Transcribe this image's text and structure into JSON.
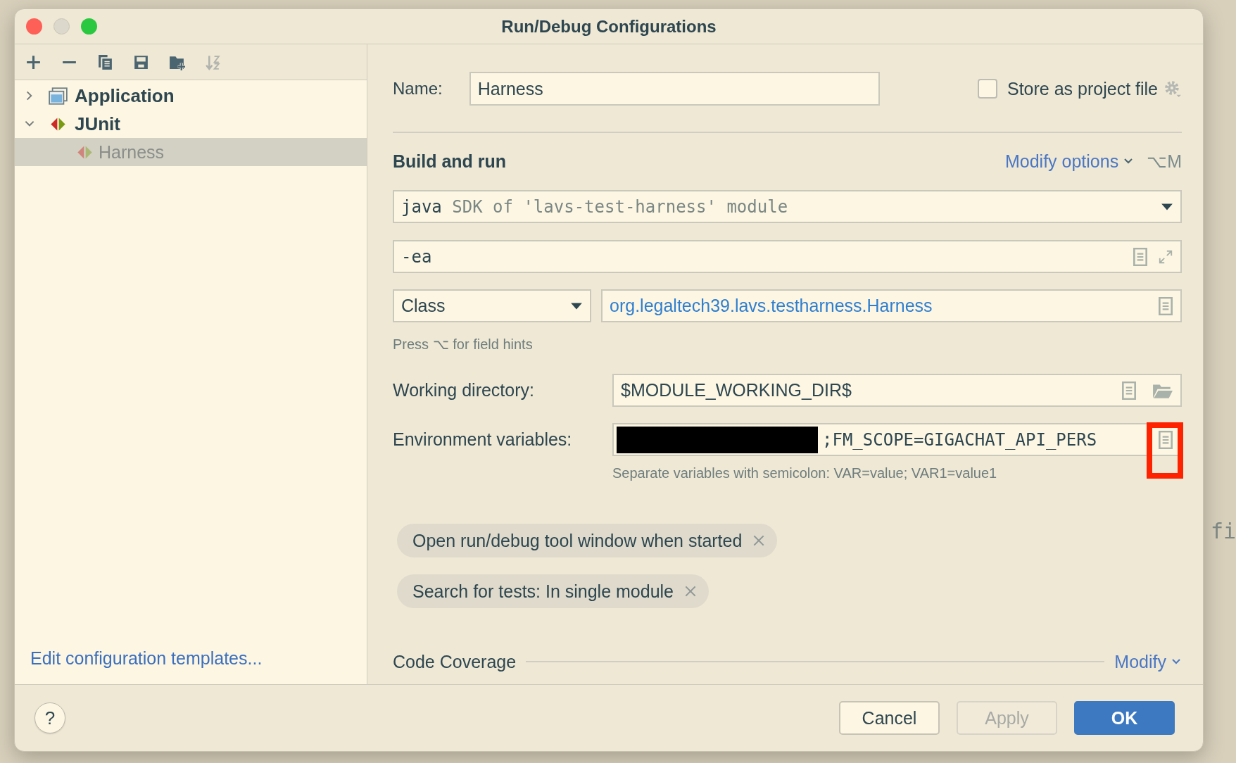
{
  "window": {
    "title": "Run/Debug Configurations"
  },
  "tree": [
    {
      "label": "Application",
      "kind": "application",
      "expanded": false,
      "selected": false
    },
    {
      "label": "JUnit",
      "kind": "junit",
      "expanded": true,
      "selected": false,
      "children": [
        {
          "label": "Harness",
          "selected": true,
          "dimmed": true
        }
      ]
    }
  ],
  "templates_link": "Edit configuration templates...",
  "name": {
    "label": "Name:",
    "value": "Harness"
  },
  "store_as_project_file": {
    "label": "Store as project file",
    "checked": false
  },
  "build_and_run": {
    "title": "Build and run",
    "modify_options": "Modify options",
    "shortcut": "⌥M",
    "jre": {
      "value": "java",
      "hint": "SDK of 'lavs-test-harness' module"
    },
    "vm_options": "-ea",
    "test_kind": "Class",
    "class_name": "org.legaltech39.lavs.testharness.Harness",
    "field_hint": "Press ⌥ for field hints"
  },
  "working_directory": {
    "label": "Working directory:",
    "value": "$MODULE_WORKING_DIR$"
  },
  "environment_variables": {
    "label": "Environment variables:",
    "redacted": true,
    "value": ";FM_SCOPE=GIGACHAT_API_PERS",
    "highlighted": true,
    "help": "Separate variables with semicolon: VAR=value; VAR1=value1"
  },
  "options": [
    {
      "label": "Open run/debug tool window when started"
    },
    {
      "label": "Search for tests: In single module"
    }
  ],
  "code_coverage": {
    "title": "Code Coverage",
    "modify": "Modify"
  },
  "buttons": [
    {
      "label": "Cancel",
      "kind": "secondary",
      "disabled": false
    },
    {
      "label": "Apply",
      "kind": "secondary",
      "disabled": true
    },
    {
      "label": "OK",
      "kind": "primary",
      "disabled": false
    }
  ],
  "help_button": "?",
  "background": {
    "editor_text": "fi"
  }
}
